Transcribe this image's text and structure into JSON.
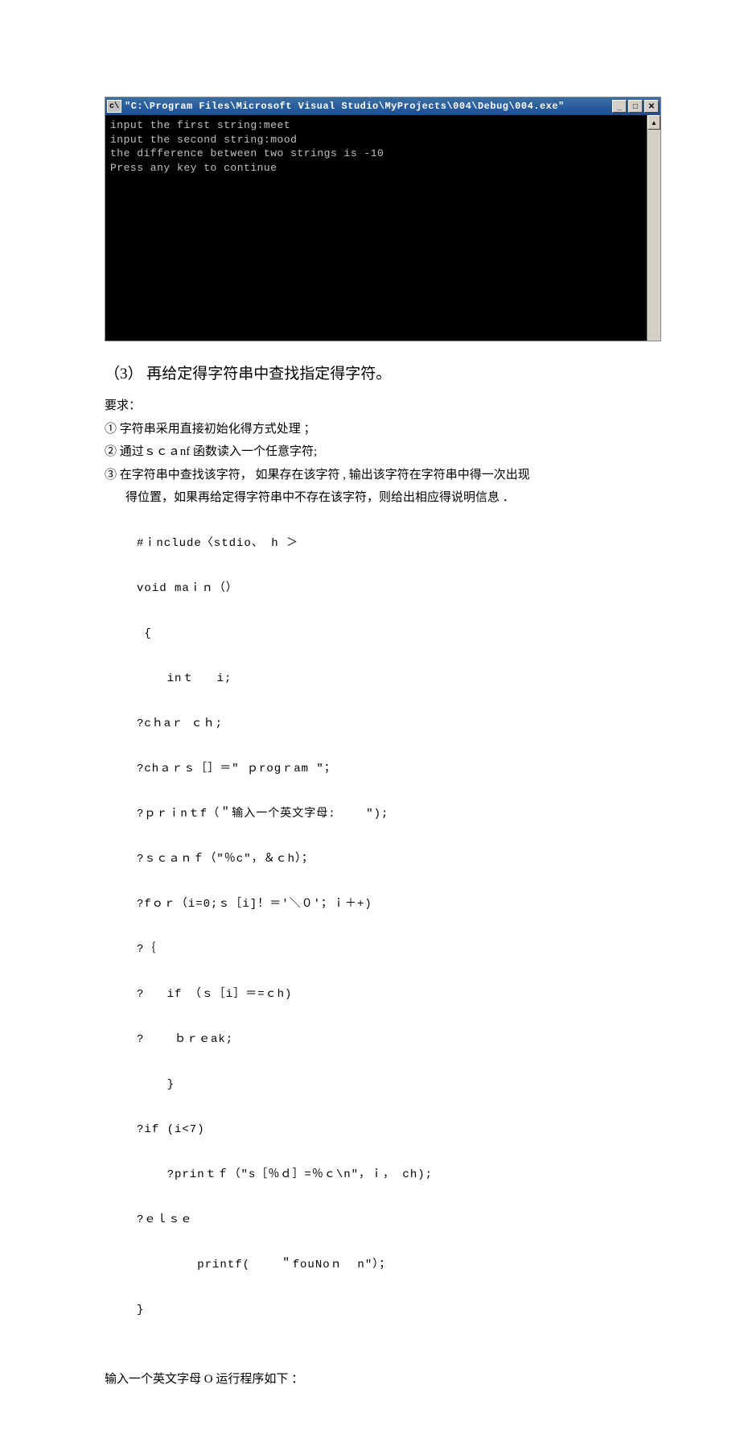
{
  "console": {
    "icon_label": "c\\",
    "title": "\"C:\\Program Files\\Microsoft Visual Studio\\MyProjects\\004\\Debug\\004.exe\"",
    "buttons": {
      "min": "_",
      "max": "□",
      "close": "✕",
      "up": "▲"
    },
    "lines": [
      "input the first string:meet",
      "input the second string:mood",
      "the difference between two strings is -10",
      "Press any key to continue"
    ]
  },
  "section": {
    "heading": "（3） 再给定得字符串中查找指定得字符。",
    "req_label": "要求：",
    "req1": "① 字符串采用直接初始化得方式处理   ；",
    "req2": "② 通过ｓｃａnf 函数读入一个任意字符;",
    "req3a": "③ 在字符串中查找该字符， 如果存在该字符 , 输出该字符在字符串中得一次出现",
    "req3b": "得位置，如果再给定得字符串中不存在该字符，则给出相应得说明信息      ．"
  },
  "code": {
    "l1": "#ｉnclude〈stdio、 h ＞",
    "l2": "void maｉｎ（）",
    "l3": " {",
    "l4": "    inｔ   i;",
    "l5": "?cｈaｒ ｃｈ;",
    "l6": "?chａｒｓ［］＝\" ｐrogｒam \"；",
    "l7": "?ｐｒｉnｔf（＂输入一个英文字母:    \");",
    "l8": "?ｓｃａｎｆ（\"％c\"，＆ｃh）；",
    "l9": "?fｏｒ（i=0;ｓ［i]！＝'＼０'；ｉ＋+)",
    "l10": "?｛",
    "l11": "?   if （ｓ［i］＝=ｃh)",
    "l12": "?    ｂｒｅak;",
    "l13": "    }",
    "l14": "?if (i<7)",
    "l15": "    ?prinｔｆ（\"s［％ｄ］=％ｃ\\n\"，ｉ， ch);",
    "l16": "?ｅｌｓｅ",
    "l17": "        printf(    ＂fouNoｎ  n\"）；",
    "l18": "}"
  },
  "final": "输入一个英文字母   O 运行程序如下 ："
}
